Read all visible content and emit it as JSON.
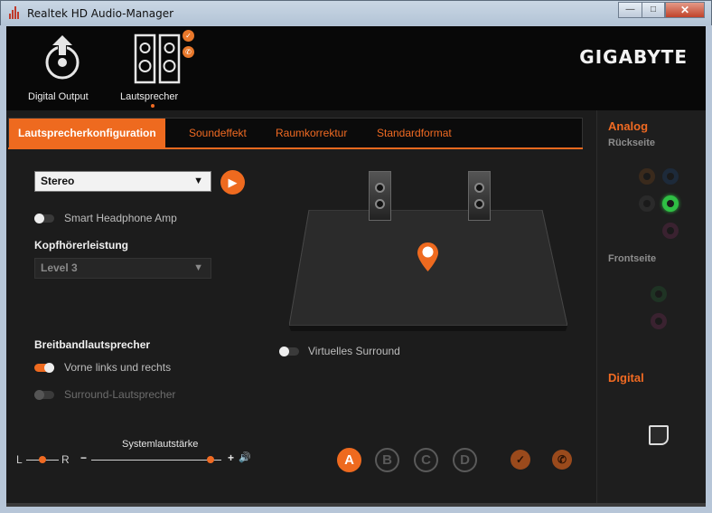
{
  "window": {
    "title": "Realtek HD Audio-Manager",
    "minimize": "—",
    "maximize": "□",
    "close": "✕"
  },
  "brand": "GIGABYTE",
  "devices": [
    {
      "label": "Digital Output"
    },
    {
      "label": "Lautsprecher"
    }
  ],
  "badges": {
    "check": "✓",
    "phone": "✆"
  },
  "tabs": [
    "Lautsprecherkonfiguration",
    "Soundeffekt",
    "Raumkorrektur",
    "Standardformat"
  ],
  "config": {
    "speaker_select": "Stereo",
    "dropdown_arrow": "▼",
    "play_icon": "▶",
    "smart_headphone_label": "Smart Headphone Amp",
    "headphone_heading": "Kopfhörerleistung",
    "headphone_level": "Level 3",
    "broadband_heading": "Breitbandlautsprecher",
    "front_lr_label": "Vorne links und rechts",
    "surround_label": "Surround-Lautsprecher",
    "virtual_surround_label": "Virtuelles Surround"
  },
  "volume": {
    "label": "Systemlautstärke",
    "balance_left": "L",
    "balance_right": "R",
    "minus": "−",
    "plus": "+",
    "speaker_icon": "🔊",
    "level": 0.92,
    "balance": 0.5
  },
  "profiles": [
    "A",
    "B",
    "C",
    "D"
  ],
  "right_panel": {
    "analog_title": "Analog",
    "rear_label": "Rückseite",
    "front_label": "Frontseite",
    "digital_title": "Digital"
  },
  "utility_icons": {
    "settings": "⚙",
    "tools": "🔧",
    "info": "ⓘ"
  },
  "colors": {
    "accent": "#ee6a1f",
    "background": "#1c1c1c",
    "jack_green": "#2fbf44"
  }
}
